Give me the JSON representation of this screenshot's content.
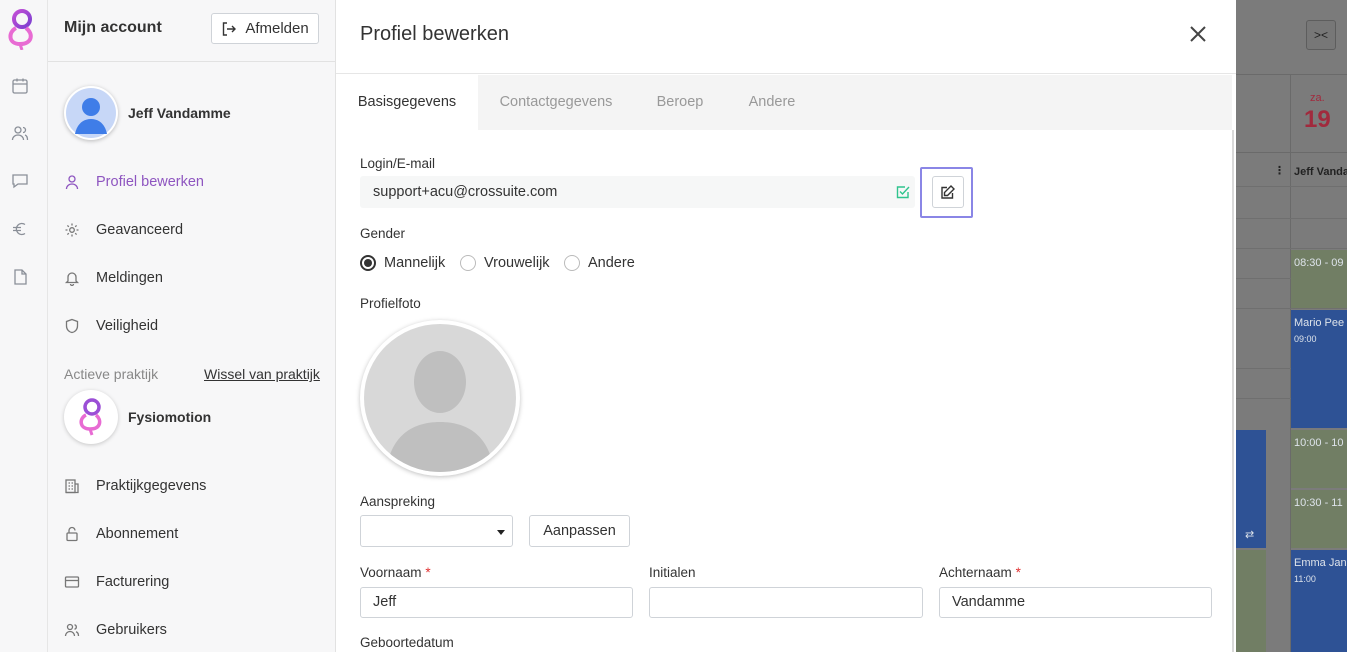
{
  "rail": {
    "icons": [
      "calendar-icon",
      "users-icon",
      "chat-icon",
      "euro-icon",
      "document-icon"
    ]
  },
  "account": {
    "title": "Mijn account",
    "logout_label": "Afmelden",
    "user_name": "Jeff Vandamme",
    "menu": [
      {
        "label": "Profiel bewerken",
        "icon": "user-icon",
        "active": true
      },
      {
        "label": "Geavanceerd",
        "icon": "gear-icon",
        "active": false
      },
      {
        "label": "Meldingen",
        "icon": "bell-icon",
        "active": false
      },
      {
        "label": "Veiligheid",
        "icon": "shield-icon",
        "active": false
      }
    ],
    "practice_label": "Actieve praktijk",
    "practice_switch": "Wissel van praktijk",
    "practice_name": "Fysiomotion",
    "practice_menu": [
      {
        "label": "Praktijkgegevens",
        "icon": "building-icon"
      },
      {
        "label": "Abonnement",
        "icon": "lock-icon"
      },
      {
        "label": "Facturering",
        "icon": "credit-card-icon"
      },
      {
        "label": "Gebruikers",
        "icon": "users-icon"
      }
    ]
  },
  "modal": {
    "title": "Profiel bewerken",
    "tabs": [
      "Basisgegevens",
      "Contactgegevens",
      "Beroep",
      "Andere"
    ],
    "active_tab": "Basisgegevens",
    "login_label": "Login/E-mail",
    "login_value": "support+acu@crossuite.com",
    "gender_label": "Gender",
    "gender_options": [
      "Mannelijk",
      "Vrouwelijk",
      "Andere"
    ],
    "gender_selected": "Mannelijk",
    "photo_label": "Profielfoto",
    "salutation_label": "Aanspreking",
    "salutation_value": "",
    "adjust_button": "Aanpassen",
    "firstname_label": "Voornaam",
    "firstname_value": "Jeff",
    "initials_label": "Initialen",
    "initials_value": "",
    "lastname_label": "Achternaam",
    "lastname_value": "Vandamme",
    "required_mark": "*",
    "birthdate_label": "Geboortedatum"
  },
  "calendar": {
    "day_abbr": "za.",
    "day_num": "19",
    "col_header": "Jeff Vanda",
    "events": [
      {
        "label": "08:30 - 09",
        "sub": ""
      },
      {
        "label": "Mario Pee",
        "sub": "09:00"
      },
      {
        "label": "10:00 - 10",
        "sub": ""
      },
      {
        "label": "10:30 - 11",
        "sub": ""
      },
      {
        "label": "Emma Jan",
        "sub": "11:00"
      }
    ]
  },
  "colors": {
    "accent": "#8e55c0",
    "focus": "#8a86e6",
    "success": "#2fc48d",
    "required": "#e03131",
    "day_red": "#b3203c"
  }
}
